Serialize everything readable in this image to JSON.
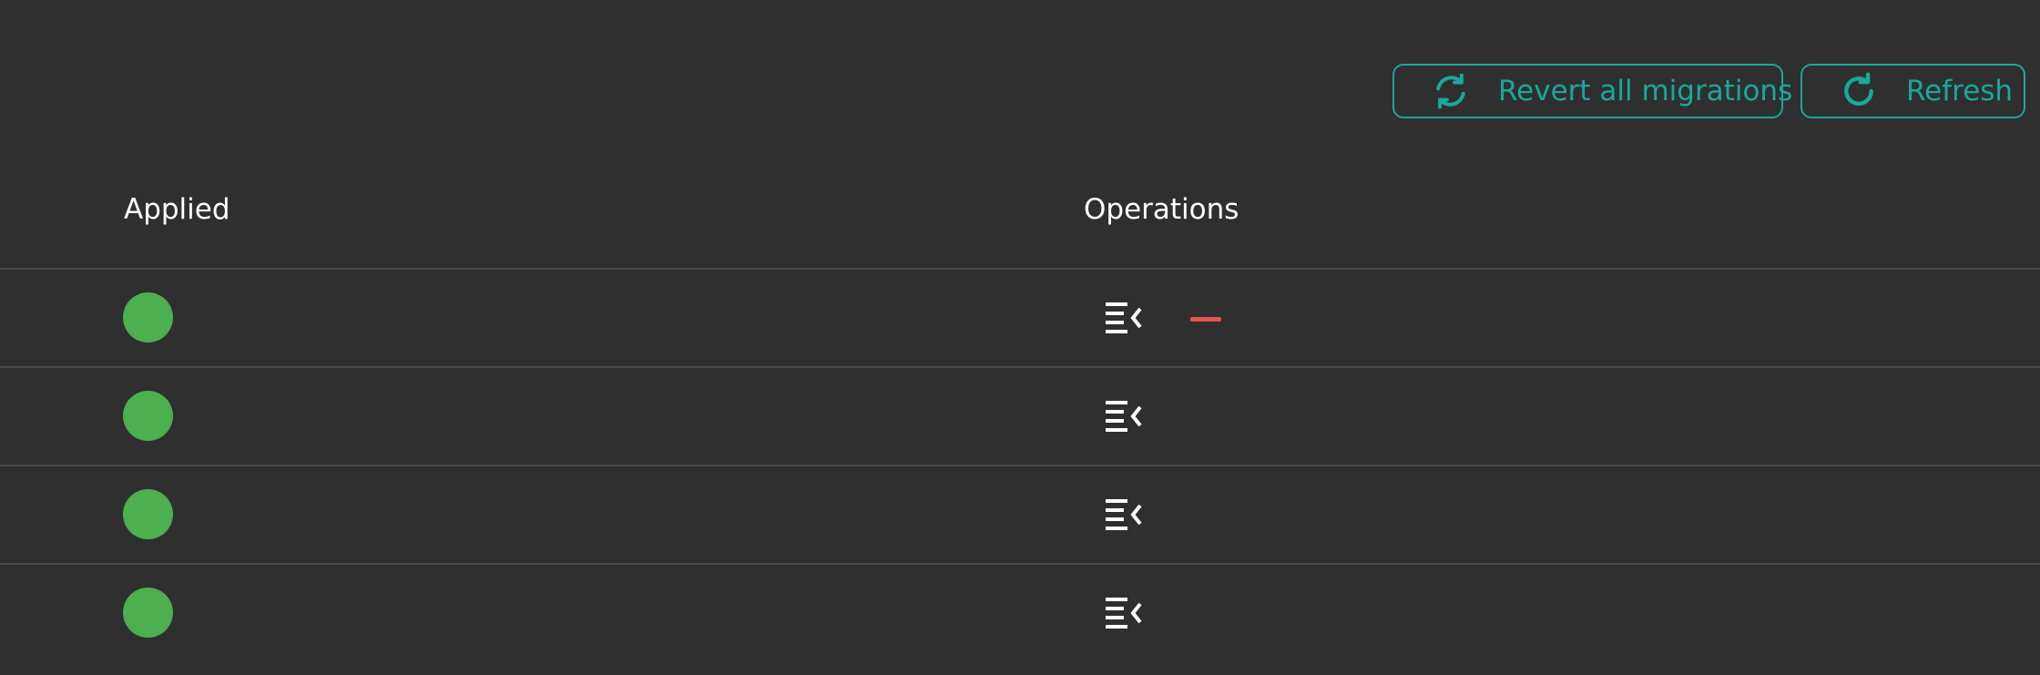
{
  "toolbar": {
    "revert_label": "Revert all migrations",
    "revert_icon": "sync-icon",
    "refresh_label": "Refresh",
    "refresh_icon": "refresh-icon"
  },
  "table": {
    "columns": [
      "Applied",
      "Operations"
    ],
    "rows": [
      {
        "applied": true,
        "operations": [
          "details-icon",
          "remove-icon"
        ]
      },
      {
        "applied": true,
        "operations": [
          "details-icon"
        ]
      },
      {
        "applied": true,
        "operations": [
          "details-icon"
        ]
      },
      {
        "applied": true,
        "operations": [
          "details-icon"
        ]
      }
    ]
  },
  "colors": {
    "background": "#2f2f2f",
    "accent": "#18a99a",
    "applied": "#4caf50",
    "danger": "#e65350",
    "divider": "#4c4c4c"
  }
}
